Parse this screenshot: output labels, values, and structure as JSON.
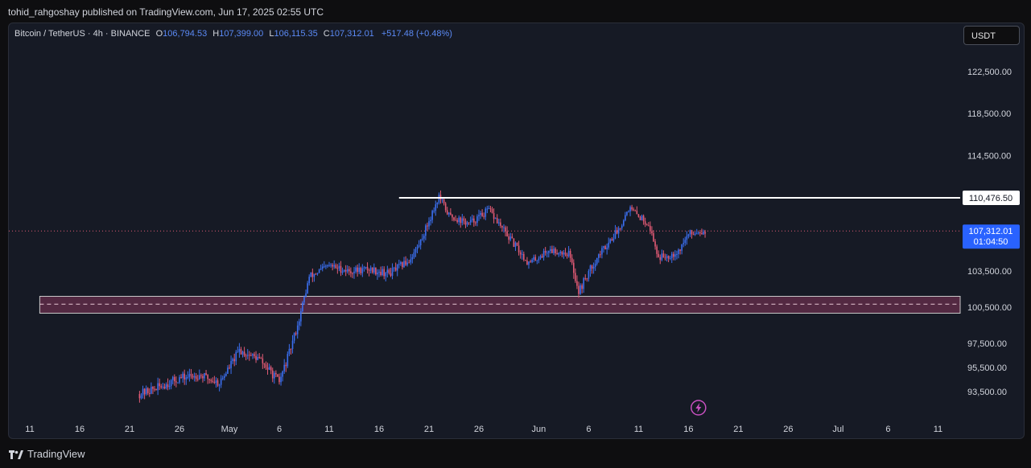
{
  "header": {
    "publisher": "tohid_rahgoshay published on TradingView.com, Jun 17, 2025 02:55 UTC"
  },
  "legend": {
    "symbol": "Bitcoin / TetherUS · 4h · BINANCE",
    "o_label": "O",
    "o": "106,794.53",
    "h_label": "H",
    "h": "107,399.00",
    "l_label": "L",
    "l": "106,115.35",
    "c_label": "C",
    "c": "107,312.01",
    "change": "+517.48 (+0.48%)"
  },
  "currency_button": "USDT",
  "footer": {
    "brand": "TradingView"
  },
  "colors": {
    "up": "#3b6ff0",
    "down": "#e05a74",
    "background": "#161a25",
    "resistance": "#ffffff",
    "support_zone": "#5e2d48",
    "last_price": "#2962ff"
  },
  "chart_data": {
    "type": "candlestick",
    "timeframe": "4h",
    "y_ticks": [
      {
        "value": 122500,
        "label": "122,500.00"
      },
      {
        "value": 118500,
        "label": "118,500.00"
      },
      {
        "value": 114500,
        "label": "114,500.00"
      },
      {
        "value": 103500,
        "label": "103,500.00"
      },
      {
        "value": 100500,
        "label": "100,500.00"
      },
      {
        "value": 97500,
        "label": "97,500.00"
      },
      {
        "value": 95500,
        "label": "95,500.00"
      },
      {
        "value": 93500,
        "label": "93,500.00"
      }
    ],
    "x_ticks": [
      "11",
      "16",
      "21",
      "26",
      "May",
      "6",
      "11",
      "16",
      "21",
      "26",
      "Jun",
      "6",
      "11",
      "16",
      "21",
      "26",
      "Jul",
      "6",
      "11"
    ],
    "x_tick_dates": [
      "2025-04-11",
      "2025-04-16",
      "2025-04-21",
      "2025-04-26",
      "2025-05-01",
      "2025-05-06",
      "2025-05-11",
      "2025-05-16",
      "2025-05-21",
      "2025-05-26",
      "2025-06-01",
      "2025-06-06",
      "2025-06-11",
      "2025-06-16",
      "2025-06-21",
      "2025-06-26",
      "2025-07-01",
      "2025-07-06",
      "2025-07-11"
    ],
    "resistance": {
      "price": 110476.5,
      "label": "110,476.50",
      "start": "2025-05-18"
    },
    "support_zone": {
      "low": 100000,
      "high": 101400,
      "mid": 100750,
      "start": "2025-04-12"
    },
    "last_price": {
      "price": 107312.01,
      "label": "107,312.01",
      "countdown": "01:04:50"
    },
    "alert_marker_date": "2025-06-17",
    "close_path": [
      [
        "2025-04-22",
        93300
      ],
      [
        "2025-04-24",
        93900
      ],
      [
        "2025-04-26",
        94600
      ],
      [
        "2025-04-28",
        94900
      ],
      [
        "2025-04-30",
        94200
      ],
      [
        "2025-05-02",
        96900
      ],
      [
        "2025-05-04",
        96200
      ],
      [
        "2025-05-06",
        94300
      ],
      [
        "2025-05-07",
        96700
      ],
      [
        "2025-05-08",
        99500
      ],
      [
        "2025-05-09",
        103000
      ],
      [
        "2025-05-11",
        104000
      ],
      [
        "2025-05-13",
        103500
      ],
      [
        "2025-05-15",
        103700
      ],
      [
        "2025-05-17",
        103300
      ],
      [
        "2025-05-19",
        104500
      ],
      [
        "2025-05-20",
        106000
      ],
      [
        "2025-05-22",
        110600
      ],
      [
        "2025-05-23",
        108800
      ],
      [
        "2025-05-25",
        108000
      ],
      [
        "2025-05-27",
        109300
      ],
      [
        "2025-05-29",
        106700
      ],
      [
        "2025-05-31",
        104200
      ],
      [
        "2025-06-02",
        105500
      ],
      [
        "2025-06-04",
        105200
      ],
      [
        "2025-06-05",
        101800
      ],
      [
        "2025-06-07",
        105000
      ],
      [
        "2025-06-09",
        107500
      ],
      [
        "2025-06-10",
        109500
      ],
      [
        "2025-06-12",
        108000
      ],
      [
        "2025-06-13",
        104800
      ],
      [
        "2025-06-14",
        105000
      ],
      [
        "2025-06-15",
        105400
      ],
      [
        "2025-06-16",
        107000
      ],
      [
        "2025-06-17",
        107312
      ]
    ]
  }
}
